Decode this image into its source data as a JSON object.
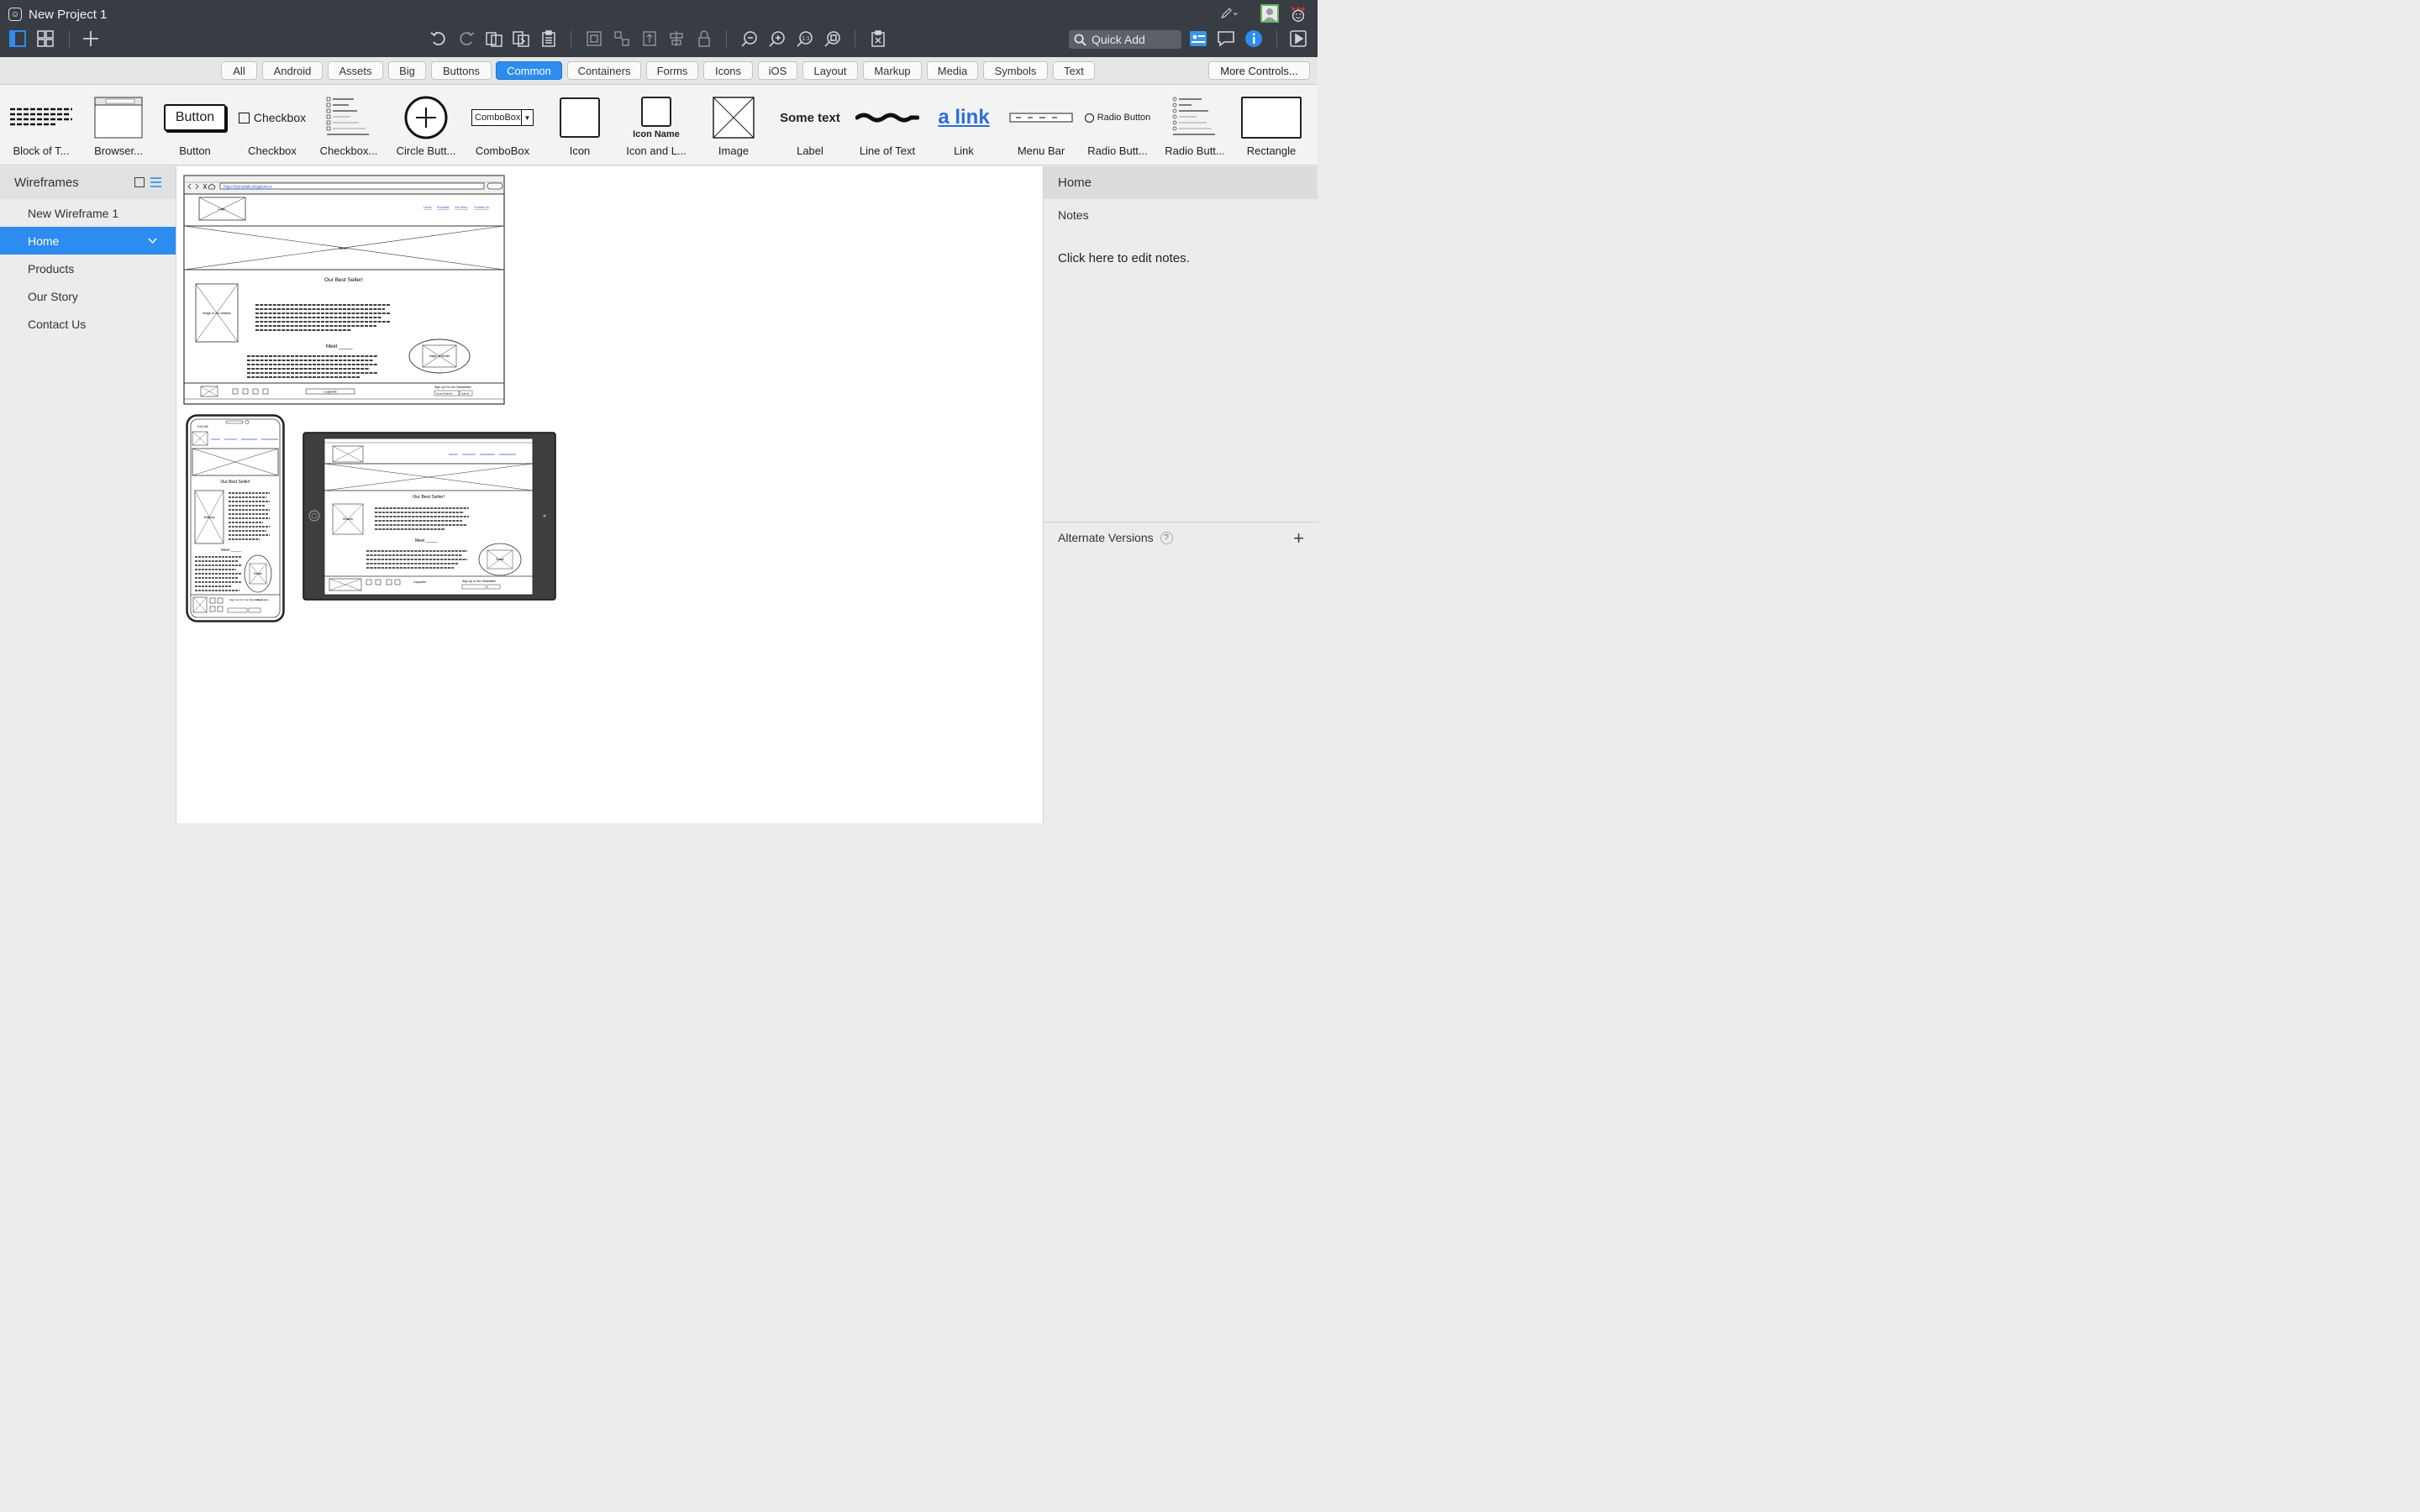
{
  "window": {
    "title": "New Project 1"
  },
  "toolbar": {
    "quick_add_placeholder": "Quick Add",
    "icons": [
      "wireframe-view-icon",
      "grid-view-icon",
      "add-icon",
      "undo-icon",
      "redo-icon",
      "duplicate-icon",
      "copy-icon",
      "paste-icon",
      "group-icon",
      "ungroup-icon",
      "align-icon",
      "distribute-icon",
      "lock-icon",
      "zoom-out-icon",
      "zoom-in-icon",
      "actual-size-icon",
      "zoom-fit-icon",
      "clear-icon",
      "pencil-icon",
      "user-icon",
      "monkey-icon",
      "project-info-icon",
      "comment-icon",
      "info-icon",
      "present-icon"
    ]
  },
  "filters": {
    "chips": [
      "All",
      "Android",
      "Assets",
      "Big",
      "Buttons",
      "Common",
      "Containers",
      "Forms",
      "Icons",
      "iOS",
      "Layout",
      "Markup",
      "Media",
      "Symbols",
      "Text"
    ],
    "active": "Common",
    "more": "More Controls..."
  },
  "library": {
    "items": [
      {
        "label": "Block of T...",
        "thumb": "block-text"
      },
      {
        "label": "Browser...",
        "thumb": "browser"
      },
      {
        "label": "Button",
        "thumb": "button",
        "thumb_text": "Button"
      },
      {
        "label": "Checkbox",
        "thumb": "checkbox",
        "thumb_text": "Checkbox"
      },
      {
        "label": "Checkbox...",
        "thumb": "checkbox-group"
      },
      {
        "label": "Circle Butt...",
        "thumb": "circle-button"
      },
      {
        "label": "ComboBox",
        "thumb": "combobox",
        "thumb_text": "ComboBox"
      },
      {
        "label": "Icon",
        "thumb": "icon"
      },
      {
        "label": "Icon and L...",
        "thumb": "icon-label",
        "thumb_text": "Icon Name"
      },
      {
        "label": "Image",
        "thumb": "image"
      },
      {
        "label": "Label",
        "thumb": "label",
        "thumb_text": "Some text"
      },
      {
        "label": "Line of Text",
        "thumb": "line-text"
      },
      {
        "label": "Link",
        "thumb": "link",
        "thumb_text": "a link"
      },
      {
        "label": "Menu Bar",
        "thumb": "menu-bar"
      },
      {
        "label": "Radio Butt...",
        "thumb": "radio",
        "thumb_text": "Radio Button"
      },
      {
        "label": "Radio Butt...",
        "thumb": "radio-group"
      },
      {
        "label": "Rectangle",
        "thumb": "rectangle"
      }
    ]
  },
  "sidebar": {
    "title": "Wireframes",
    "items": [
      {
        "label": "New Wireframe 1",
        "selected": false
      },
      {
        "label": "Home",
        "selected": true
      },
      {
        "label": "Products",
        "selected": false
      },
      {
        "label": "Our Story",
        "selected": false
      },
      {
        "label": "Contact Us",
        "selected": false
      }
    ]
  },
  "right_panel": {
    "title": "Home",
    "notes_label": "Notes",
    "notes_placeholder": "Click here to edit notes.",
    "alternate_versions": "Alternate Versions",
    "help": "?"
  },
  "wireframes": {
    "desktop": {
      "url": "https://lyonsdale-drugstore.ie",
      "nav": [
        "Home",
        "Products",
        "Our Story",
        "Contact Us"
      ],
      "logo": "Logo",
      "slider": "Slider",
      "heading": "Our Best Seller!",
      "image_caption": "Image of our whiskey",
      "meet": "Meet _____",
      "ellipse_caption": "Image of Declan",
      "copyright": "Copywrite",
      "newsletter": "Sign Up For Our Newsletter!",
      "email": "Email Address",
      "submit": "Submit"
    },
    "phone": {
      "time": "9:41 AM",
      "heading": "Our Best Seller!",
      "image_caption": "Whiskey",
      "meet": "Meet _____",
      "ellipse_caption": "Declan",
      "newsletter": "Sign Up For Our Newsletter!",
      "copyright": "Copywrite"
    },
    "tablet": {
      "heading": "Our Best Seller!",
      "image_caption": "Whiskey",
      "meet": "Meet _____",
      "ellipse_caption": "Declan",
      "copyright": "Copywrite",
      "newsletter": "Sign Up to Our Newsletter!"
    }
  },
  "colors": {
    "accent": "#2d8cf0",
    "toolbar_bg": "#383c43"
  }
}
